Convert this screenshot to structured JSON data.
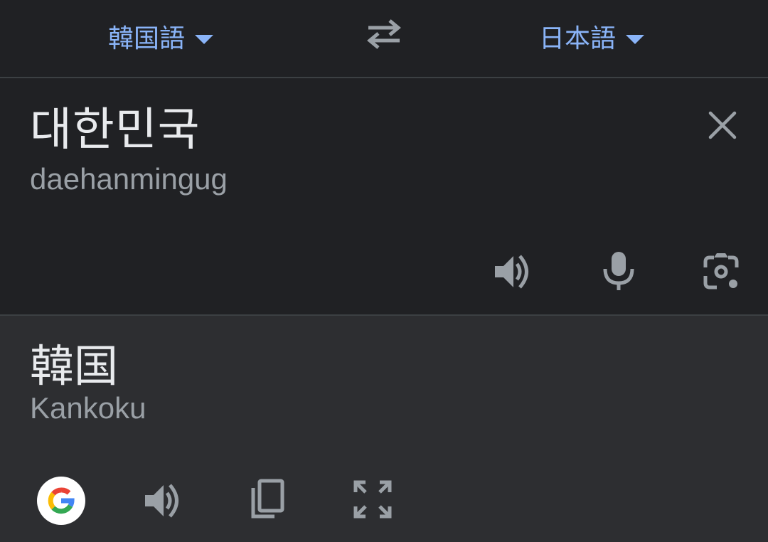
{
  "language_bar": {
    "source_language": "韓国語",
    "target_language": "日本語"
  },
  "source": {
    "text": "대한민국",
    "transliteration": "daehanmingug"
  },
  "translation": {
    "text": "韓国",
    "transliteration": "Kankoku"
  },
  "icons": {
    "swap": "swap-arrows-icon",
    "clear": "close-icon",
    "source_speaker": "speaker-icon",
    "mic": "microphone-icon",
    "camera": "camera-lens-icon",
    "google": "google-logo",
    "target_speaker": "speaker-icon",
    "copy": "copy-icon",
    "fullscreen": "fullscreen-icon"
  },
  "colors": {
    "accent": "#8ab4f8",
    "icon": "#9aa0a6",
    "text": "#e8eaed",
    "background": "#202124",
    "result_background": "#2d2e31"
  }
}
